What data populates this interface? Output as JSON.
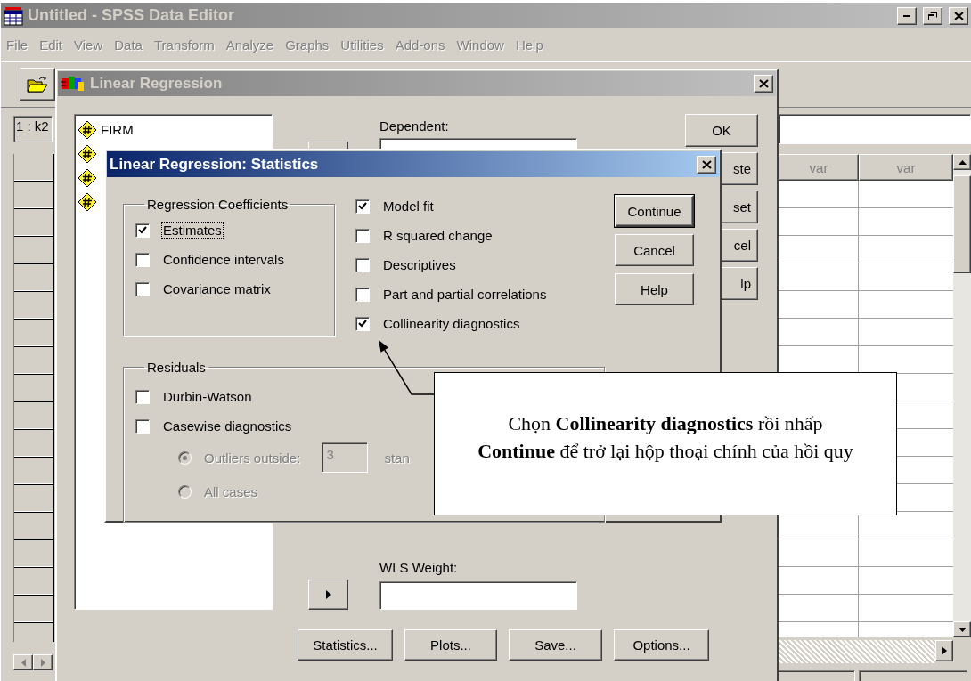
{
  "main_window": {
    "title": "Untitled - SPSS Data Editor",
    "active": false,
    "menu": [
      {
        "label": "File",
        "disabled": true
      },
      {
        "label": "Edit",
        "disabled": true
      },
      {
        "label": "View",
        "disabled": true
      },
      {
        "label": "Data",
        "disabled": true
      },
      {
        "label": "Transform",
        "disabled": true
      },
      {
        "label": "Analyze",
        "disabled": true
      },
      {
        "label": "Graphs",
        "disabled": true
      },
      {
        "label": "Utilities",
        "disabled": true
      },
      {
        "label": "Add-ons",
        "disabled": true
      },
      {
        "label": "Window",
        "disabled": true
      },
      {
        "label": "Help",
        "disabled": true
      }
    ],
    "cell_reference": "1 : k2",
    "columns": [
      "var",
      "var"
    ]
  },
  "regression_dialog": {
    "title": "Linear Regression",
    "active": false,
    "variables": [
      {
        "kind": "named",
        "name": "FIRM"
      },
      {
        "kind": "covered"
      },
      {
        "kind": "covered"
      },
      {
        "kind": "covered"
      }
    ],
    "dependent_label": "Dependent:",
    "side_buttons": [
      {
        "label": "OK",
        "kind": "whole"
      },
      {
        "label": "ste",
        "kind": "covered"
      },
      {
        "label": "set",
        "kind": "covered"
      },
      {
        "label": "cel",
        "kind": "covered"
      },
      {
        "label": "lp",
        "kind": "covered"
      }
    ],
    "wls_label": "WLS Weight:",
    "bottom_buttons": [
      "Statistics...",
      "Plots...",
      "Save...",
      "Options..."
    ]
  },
  "statistics_dialog": {
    "title": "Linear Regression: Statistics",
    "active": true,
    "coefficients": {
      "title": "Regression Coefficients",
      "options": [
        {
          "label": "Estimates",
          "checked": true,
          "focused": true
        },
        {
          "label": "Confidence intervals",
          "checked": false,
          "focused": false
        },
        {
          "label": "Covariance matrix",
          "checked": false,
          "focused": false
        }
      ]
    },
    "options": [
      {
        "label": "Model fit",
        "checked": true
      },
      {
        "label": "R squared change",
        "checked": false
      },
      {
        "label": "Descriptives",
        "checked": false
      },
      {
        "label": "Part and partial correlations",
        "checked": false
      },
      {
        "label": "Collinearity diagnostics",
        "checked": true
      }
    ],
    "buttons": [
      {
        "label": "Continue",
        "default": true
      },
      {
        "label": "Cancel",
        "default": false
      },
      {
        "label": "Help",
        "default": false
      }
    ],
    "residuals": {
      "title": "Residuals",
      "options": [
        {
          "label": "Durbin-Watson",
          "checked": false
        },
        {
          "label": "Casewise diagnostics",
          "checked": false
        }
      ],
      "radios": [
        {
          "label": "Outliers outside:",
          "selected": true,
          "disabled": true
        },
        {
          "label": "All cases",
          "selected": false,
          "disabled": true
        }
      ],
      "limit": {
        "value": "3",
        "unit": "stan",
        "disabled": true
      }
    }
  },
  "callout": {
    "text": "Chọn **Collinearity diagnostics** rồi nhấp **Continue** để trở lại hộp thoại chính của hồi quy"
  }
}
